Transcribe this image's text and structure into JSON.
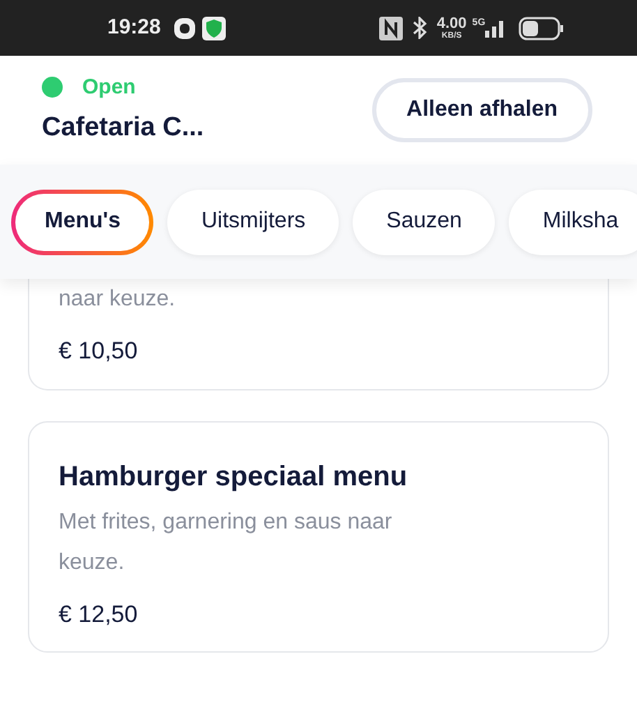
{
  "status_bar": {
    "time": "19:28",
    "speed": "4.00",
    "speed_unit": "KB/S",
    "network": "5G"
  },
  "header": {
    "status": "Open",
    "open": true,
    "title": "Cafetaria C...",
    "button": "Alleen afhalen"
  },
  "categories": [
    {
      "label": "Menu's",
      "selected": true
    },
    {
      "label": "Uitsmijters",
      "selected": false
    },
    {
      "label": "Sauzen",
      "selected": false
    },
    {
      "label": "Milksha",
      "selected": false
    }
  ],
  "products": [
    {
      "description": "naar keuze.",
      "price": "€ 10,50"
    },
    {
      "title": "Hamburger speciaal menu",
      "description": "Met frites, garnering en saus naar keuze.",
      "price": "€ 12,50"
    }
  ]
}
